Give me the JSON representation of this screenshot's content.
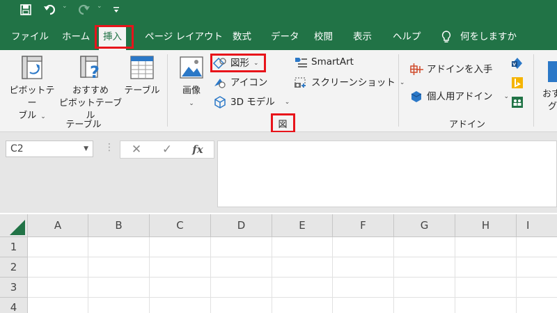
{
  "colors": {
    "accent": "#217346",
    "highlight": "#e8141b",
    "ribbon_bg": "#f3f3f3"
  },
  "qat": {
    "icons": [
      "save-icon",
      "undo-icon",
      "redo-icon",
      "customize-qat-icon"
    ]
  },
  "tabs": [
    {
      "label": "ファイル"
    },
    {
      "label": "ホーム"
    },
    {
      "label": "挿入",
      "active": true
    },
    {
      "label": "ページ レイアウト"
    },
    {
      "label": "数式"
    },
    {
      "label": "データ"
    },
    {
      "label": "校閲"
    },
    {
      "label": "表示"
    },
    {
      "label": "ヘルプ"
    }
  ],
  "tell_me": "何をしますか",
  "ribbon": {
    "tables": {
      "pivot_line1": "ピボットテー",
      "pivot_line2": "ブル",
      "rec_pivot_line1": "おすすめ",
      "rec_pivot_line2": "ピボットテーブル",
      "table": "テーブル",
      "group": "テーブル"
    },
    "illustrations": {
      "image": "画像",
      "shapes": "図形",
      "icons": "アイコン",
      "models_3d": "3D モデル",
      "smartart": "SmartArt",
      "screenshot": "スクリーンショット",
      "group": "図"
    },
    "addins": {
      "get_addins": "アドインを入手",
      "my_addins": "個人用アドイン",
      "group": "アドイン"
    },
    "recommended_charts_partial_1": "おす",
    "recommended_charts_partial_2": "グ"
  },
  "formula_bar": {
    "name_box": "C2",
    "cancel": "✕",
    "enter": "✓",
    "fx": "fx",
    "value": ""
  },
  "grid": {
    "columns": [
      "A",
      "B",
      "C",
      "D",
      "E",
      "F",
      "G",
      "H",
      "I"
    ],
    "rows": [
      "1",
      "2",
      "3",
      "4"
    ]
  }
}
